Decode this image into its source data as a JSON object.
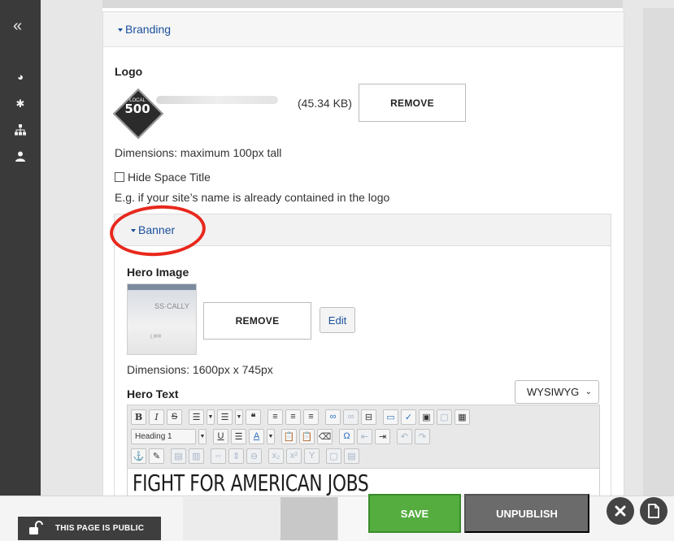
{
  "sidebar": {
    "collapse_glyph": "«",
    "icons": [
      "palette-icon",
      "gear-icon",
      "sitemap-icon",
      "user-icon"
    ]
  },
  "branding": {
    "section_label": "Branding",
    "logo_label": "Logo",
    "logo_badge_top": "LOCAL",
    "logo_badge_number": "500",
    "logo_size": "(45.34 KB)",
    "remove_label": "REMOVE",
    "dimensions_text": "Dimensions: maximum 100px tall",
    "hide_title_label": "Hide Space Title",
    "hide_title_hint": "E.g. if your site’s name is already contained in the logo"
  },
  "banner": {
    "section_label": "Banner",
    "hero_image_label": "Hero Image",
    "remove_label": "REMOVE",
    "edit_label": "Edit",
    "dimensions_text": "Dimensions: 1600px x 745px",
    "hero_text_label": "Hero Text",
    "editor_mode": "WYSIWYG",
    "format_select": "Heading 1",
    "editor_content": "FIGHT FOR AMERICAN JOBS"
  },
  "footer": {
    "public_label": "THIS PAGE IS PUBLIC",
    "save_label": "SAVE",
    "unpublish_label": "UNPUBLISH"
  },
  "colors": {
    "accent_link": "#1a4f9c",
    "save_green": "#55ad40",
    "unpublish_gray": "#6b6b6b",
    "annotation_red": "#e8281c",
    "sidebar_dark": "#3a3a3a"
  }
}
